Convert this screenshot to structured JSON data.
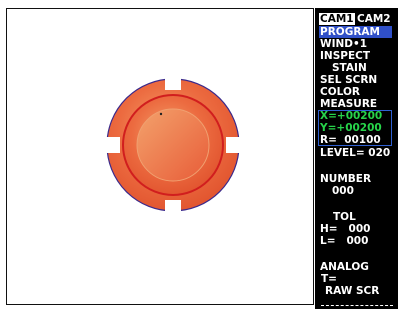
{
  "panel": {
    "cam1": "CAM1",
    "cam2": "CAM2",
    "program": "PROGRAM",
    "wind": "WIND•1",
    "inspect": "INSPECT",
    "stain": "STAIN",
    "sel_scrn": "SEL SCRN",
    "color": "COLOR",
    "measure": "MEASURE",
    "x": "X=+00200",
    "y": "Y=+00200",
    "r": "R=  00100",
    "level": "LEVEL= 020",
    "number_label": "NUMBER",
    "number_value": "000",
    "tol_label": "TOL",
    "h": "H=   000",
    "l": "L=   000",
    "analog": "ANALOG",
    "t": "T=",
    "raw_scr": "RAW SCR"
  },
  "colors": {
    "panel_bg": "#000000",
    "highlight_blue": "#3050c8",
    "coord_green": "#27d44a",
    "target_orange": "#ec6b40",
    "target_red": "#d11e1e",
    "target_outline": "#3b2a8c"
  }
}
